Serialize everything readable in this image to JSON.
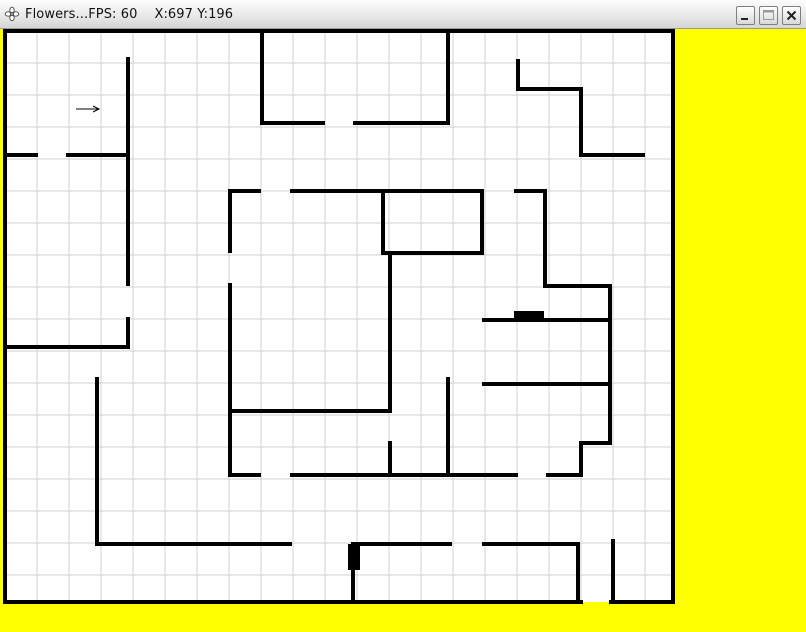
{
  "window": {
    "title": "Flowers...FPS: 60    X:697 Y:196",
    "app_icon": "flower-icon",
    "controls": [
      {
        "name": "minimize-button",
        "icon": "minimize-icon"
      },
      {
        "name": "maximize-button",
        "icon": "maximize-icon"
      },
      {
        "name": "close-button",
        "icon": "close-icon"
      }
    ]
  },
  "game": {
    "background_color": "#ffff00",
    "floor_color": "#ffffff",
    "grid_line_color": "#d0d0d0",
    "wall_color": "#000000",
    "cursor": {
      "icon": "arrow-icon",
      "direction": "right"
    }
  }
}
